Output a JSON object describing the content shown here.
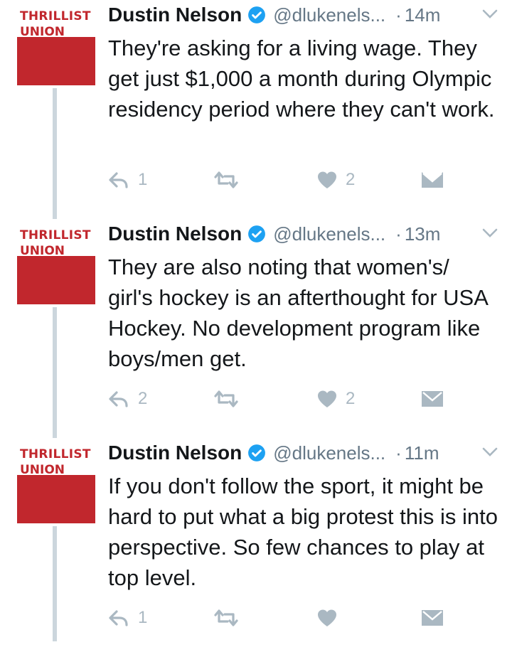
{
  "colors": {
    "brand_red": "#c1272d",
    "verified_blue": "#1da1f2",
    "icon_gray": "#aab8c2",
    "text_gray": "#657786"
  },
  "tweets": [
    {
      "avatar": {
        "brand": "THRILLIST",
        "sub": "UNION"
      },
      "name": "Dustin Nelson",
      "handle": "@dlukenels...",
      "dot": "·",
      "time": "14m",
      "text": "They're asking for a living wage. They get just $1,000 a month during Olympic residency period where they can't work.",
      "reply_count": "1",
      "like_count": "2"
    },
    {
      "avatar": {
        "brand": "THRILLIST",
        "sub": "UNION"
      },
      "name": "Dustin Nelson",
      "handle": "@dlukenels...",
      "dot": "·",
      "time": "13m",
      "text": "They are also noting that women's/ girl's hockey is an afterthought for USA Hockey. No development program like boys/men get.",
      "reply_count": "2",
      "like_count": "2"
    },
    {
      "avatar": {
        "brand": "THRILLIST",
        "sub": "UNION"
      },
      "name": "Dustin Nelson",
      "handle": "@dlukenels...",
      "dot": "·",
      "time": "11m",
      "text": "If you don't follow the sport, it might be hard to put what a big protest this is into perspective. So few chances to play at top level.",
      "reply_count": "1",
      "like_count": ""
    }
  ]
}
